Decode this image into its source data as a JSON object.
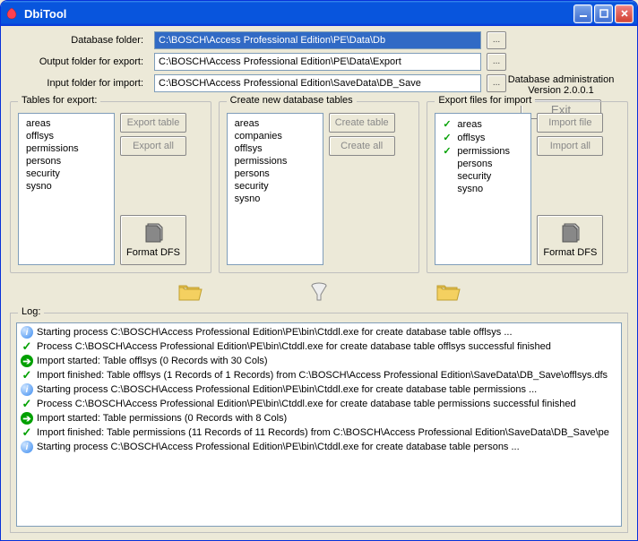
{
  "window": {
    "title": "DbiTool"
  },
  "paths": {
    "db_label": "Database folder:",
    "db_value": "C:\\BOSCH\\Access Professional Edition\\PE\\Data\\Db",
    "out_label": "Output folder for export:",
    "out_value": "C:\\BOSCH\\Access Professional Edition\\PE\\Data\\Export",
    "in_label": "Input folder for import:",
    "in_value": "C:\\BOSCH\\Access Professional Edition\\SaveData\\DB_Save",
    "browse_label": "..."
  },
  "admin": {
    "line1": "Database administration",
    "line2": "Version 2.0.0.1",
    "exit_label": "Exit"
  },
  "group_export": {
    "title": "Tables for export:",
    "items": [
      "areas",
      "offlsys",
      "permissions",
      "persons",
      "security",
      "sysno"
    ],
    "btn_export_table": "Export table",
    "btn_export_all": "Export all",
    "format_label": "Format DFS"
  },
  "group_create": {
    "title": "Create new database tables",
    "items": [
      "areas",
      "companies",
      "offlsys",
      "permissions",
      "persons",
      "security",
      "sysno"
    ],
    "btn_create_table": "Create table",
    "btn_create_all": "Create all"
  },
  "group_import": {
    "title": "Export files for import",
    "items": [
      {
        "name": "areas",
        "checked": true
      },
      {
        "name": "offlsys",
        "checked": true
      },
      {
        "name": "permissions",
        "checked": true
      },
      {
        "name": "persons",
        "checked": false
      },
      {
        "name": "security",
        "checked": false
      },
      {
        "name": "sysno",
        "checked": false
      }
    ],
    "btn_import_file": "Import file",
    "btn_import_all": "Import all",
    "format_label": "Format DFS"
  },
  "log": {
    "title": "Log:",
    "entries": [
      {
        "type": "info",
        "text": "Starting process C:\\BOSCH\\Access Professional Edition\\PE\\bin\\Ctddl.exe for create database table offlsys ..."
      },
      {
        "type": "check",
        "text": "Process C:\\BOSCH\\Access Professional Edition\\PE\\bin\\Ctddl.exe for create database table offlsys successful finished"
      },
      {
        "type": "arrow",
        "text": "Import started: Table offlsys (0 Records with 30 Cols)"
      },
      {
        "type": "check",
        "text": "Import finished: Table offlsys (1 Records of 1 Records) from C:\\BOSCH\\Access Professional Edition\\SaveData\\DB_Save\\offlsys.dfs"
      },
      {
        "type": "info",
        "text": "Starting process C:\\BOSCH\\Access Professional Edition\\PE\\bin\\Ctddl.exe for create database table permissions ..."
      },
      {
        "type": "check",
        "text": "Process C:\\BOSCH\\Access Professional Edition\\PE\\bin\\Ctddl.exe for create database table permissions successful finished"
      },
      {
        "type": "arrow",
        "text": "Import started: Table permissions (0 Records with 8 Cols)"
      },
      {
        "type": "check",
        "text": "Import finished: Table permissions (11 Records of 11 Records) from C:\\BOSCH\\Access Professional Edition\\SaveData\\DB_Save\\pe"
      },
      {
        "type": "info",
        "text": "Starting process C:\\BOSCH\\Access Professional Edition\\PE\\bin\\Ctddl.exe for create database table persons ..."
      }
    ]
  }
}
